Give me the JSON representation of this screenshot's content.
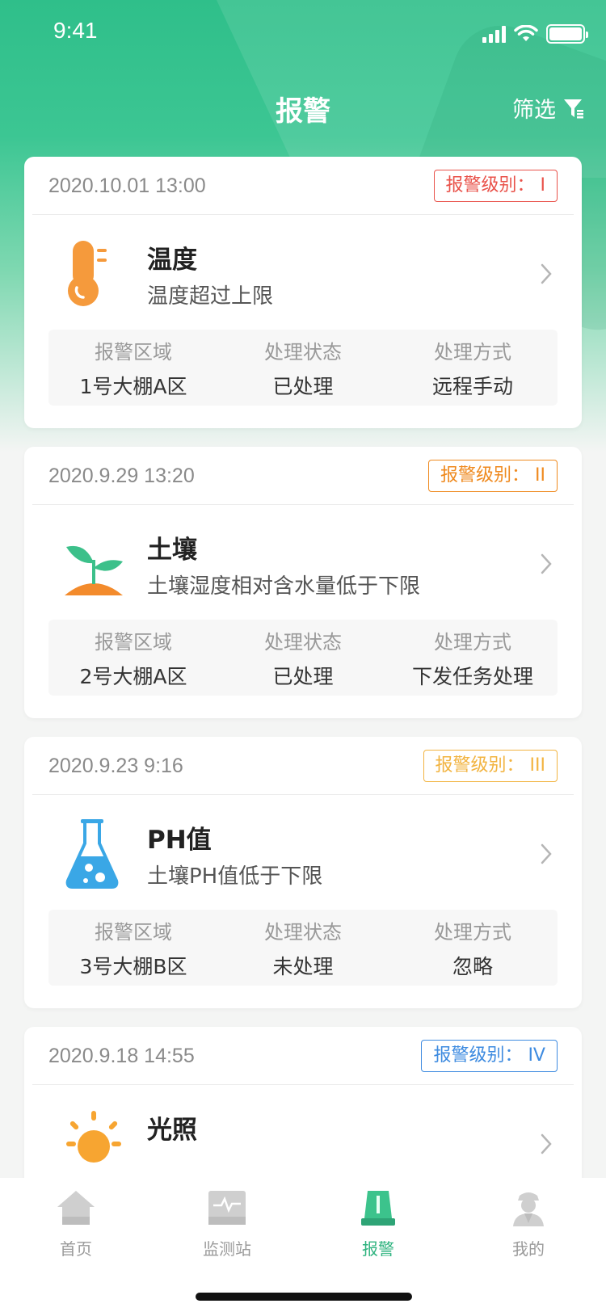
{
  "status_bar": {
    "time": "9:41"
  },
  "nav": {
    "title": "报警",
    "filter_label": "筛选"
  },
  "info_labels": {
    "area": "报警区域",
    "status": "处理状态",
    "method": "处理方式"
  },
  "alerts": [
    {
      "date": "2020.10.01 13:00",
      "level": "报警级别：  I",
      "level_color": "#e9524a",
      "title": "温度",
      "desc": "温度超过上限",
      "icon": "thermometer-icon",
      "area": "1号大棚A区",
      "status": "已处理",
      "method": "远程手动"
    },
    {
      "date": "2020.9.29 13:20",
      "level": "报警级别：  II",
      "level_color": "#ef8a1f",
      "title": "土壤",
      "desc": "土壤湿度相对含水量低于下限",
      "icon": "sprout-icon",
      "area": "2号大棚A区",
      "status": "已处理",
      "method": "下发任务处理"
    },
    {
      "date": "2020.9.23 9:16",
      "level": "报警级别：  III",
      "level_color": "#f2b441",
      "title": "PH值",
      "desc": "土壤PH值低于下限",
      "icon": "flask-icon",
      "area": "3号大棚B区",
      "status": "未处理",
      "method": "忽略"
    },
    {
      "date": "2020.9.18 14:55",
      "level": "报警级别：  IV",
      "level_color": "#3e8be0",
      "title": "光照",
      "icon": "sun-icon"
    }
  ],
  "tabs": [
    {
      "label": "首页",
      "icon": "home-icon",
      "active": false
    },
    {
      "label": "监测站",
      "icon": "monitor-station-icon",
      "active": false
    },
    {
      "label": "报警",
      "icon": "alarm-light-icon",
      "active": true
    },
    {
      "label": "我的",
      "icon": "profile-icon",
      "active": false
    }
  ]
}
